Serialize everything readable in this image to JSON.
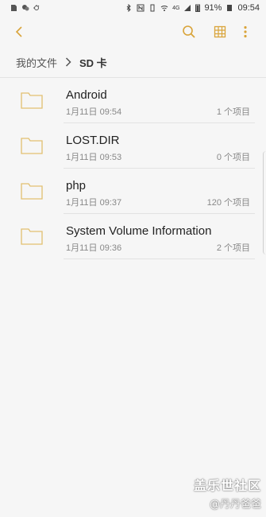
{
  "status_bar": {
    "battery": "91%",
    "time": "09:54",
    "net_label": "4G",
    "icons": [
      "sd-card-icon",
      "wechat-icon",
      "weather-icon",
      "bluetooth-icon",
      "nfc-icon",
      "vibrate-icon",
      "wifi-icon",
      "signal-icon",
      "battery-icon"
    ]
  },
  "toolbar": {
    "back_icon": "back-arrow-icon",
    "search_icon": "search-icon",
    "grid_icon": "grid-view-icon",
    "more_icon": "more-options-icon",
    "accent": "#d9a43a"
  },
  "breadcrumb": {
    "root": "我的文件",
    "current": "SD 卡"
  },
  "files": [
    {
      "name": "Android",
      "date": "1月11日 09:54",
      "count": "1 个项目"
    },
    {
      "name": "LOST.DIR",
      "date": "1月11日 09:53",
      "count": "0 个项目"
    },
    {
      "name": "php",
      "date": "1月11日 09:37",
      "count": "120 个项目"
    },
    {
      "name": "System Volume Information",
      "date": "1月11日 09:36",
      "count": "2 个项目"
    }
  ],
  "watermark": {
    "line1": "盖乐世社区",
    "line2": "@丹丹爸爸"
  }
}
